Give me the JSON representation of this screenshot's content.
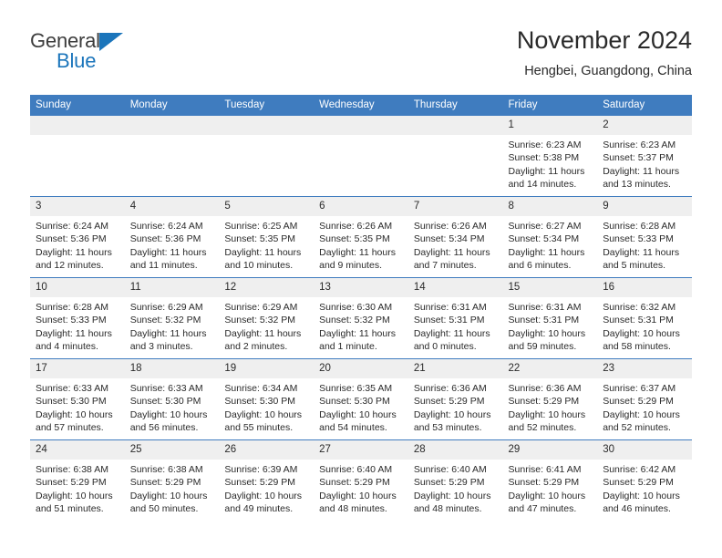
{
  "brand": {
    "line1": "General",
    "line2": "Blue",
    "triangle_color": "#1b75bb",
    "text_color": "#3d3d3d"
  },
  "header": {
    "title": "November 2024",
    "subtitle": "Hengbei, Guangdong, China"
  },
  "theme": {
    "header_row_bg": "#3f7cbf",
    "header_row_text": "#ffffff",
    "daynum_bg": "#efefef",
    "grid_line": "#3f7cbf",
    "body_text": "#2a2a2a"
  },
  "weekday_headers": [
    "Sunday",
    "Monday",
    "Tuesday",
    "Wednesday",
    "Thursday",
    "Friday",
    "Saturday"
  ],
  "weeks": [
    [
      {
        "day": "",
        "sunrise": "",
        "sunset": "",
        "daylight1": "",
        "daylight2": ""
      },
      {
        "day": "",
        "sunrise": "",
        "sunset": "",
        "daylight1": "",
        "daylight2": ""
      },
      {
        "day": "",
        "sunrise": "",
        "sunset": "",
        "daylight1": "",
        "daylight2": ""
      },
      {
        "day": "",
        "sunrise": "",
        "sunset": "",
        "daylight1": "",
        "daylight2": ""
      },
      {
        "day": "",
        "sunrise": "",
        "sunset": "",
        "daylight1": "",
        "daylight2": ""
      },
      {
        "day": "1",
        "sunrise": "Sunrise: 6:23 AM",
        "sunset": "Sunset: 5:38 PM",
        "daylight1": "Daylight: 11 hours",
        "daylight2": "and 14 minutes."
      },
      {
        "day": "2",
        "sunrise": "Sunrise: 6:23 AM",
        "sunset": "Sunset: 5:37 PM",
        "daylight1": "Daylight: 11 hours",
        "daylight2": "and 13 minutes."
      }
    ],
    [
      {
        "day": "3",
        "sunrise": "Sunrise: 6:24 AM",
        "sunset": "Sunset: 5:36 PM",
        "daylight1": "Daylight: 11 hours",
        "daylight2": "and 12 minutes."
      },
      {
        "day": "4",
        "sunrise": "Sunrise: 6:24 AM",
        "sunset": "Sunset: 5:36 PM",
        "daylight1": "Daylight: 11 hours",
        "daylight2": "and 11 minutes."
      },
      {
        "day": "5",
        "sunrise": "Sunrise: 6:25 AM",
        "sunset": "Sunset: 5:35 PM",
        "daylight1": "Daylight: 11 hours",
        "daylight2": "and 10 minutes."
      },
      {
        "day": "6",
        "sunrise": "Sunrise: 6:26 AM",
        "sunset": "Sunset: 5:35 PM",
        "daylight1": "Daylight: 11 hours",
        "daylight2": "and 9 minutes."
      },
      {
        "day": "7",
        "sunrise": "Sunrise: 6:26 AM",
        "sunset": "Sunset: 5:34 PM",
        "daylight1": "Daylight: 11 hours",
        "daylight2": "and 7 minutes."
      },
      {
        "day": "8",
        "sunrise": "Sunrise: 6:27 AM",
        "sunset": "Sunset: 5:34 PM",
        "daylight1": "Daylight: 11 hours",
        "daylight2": "and 6 minutes."
      },
      {
        "day": "9",
        "sunrise": "Sunrise: 6:28 AM",
        "sunset": "Sunset: 5:33 PM",
        "daylight1": "Daylight: 11 hours",
        "daylight2": "and 5 minutes."
      }
    ],
    [
      {
        "day": "10",
        "sunrise": "Sunrise: 6:28 AM",
        "sunset": "Sunset: 5:33 PM",
        "daylight1": "Daylight: 11 hours",
        "daylight2": "and 4 minutes."
      },
      {
        "day": "11",
        "sunrise": "Sunrise: 6:29 AM",
        "sunset": "Sunset: 5:32 PM",
        "daylight1": "Daylight: 11 hours",
        "daylight2": "and 3 minutes."
      },
      {
        "day": "12",
        "sunrise": "Sunrise: 6:29 AM",
        "sunset": "Sunset: 5:32 PM",
        "daylight1": "Daylight: 11 hours",
        "daylight2": "and 2 minutes."
      },
      {
        "day": "13",
        "sunrise": "Sunrise: 6:30 AM",
        "sunset": "Sunset: 5:32 PM",
        "daylight1": "Daylight: 11 hours",
        "daylight2": "and 1 minute."
      },
      {
        "day": "14",
        "sunrise": "Sunrise: 6:31 AM",
        "sunset": "Sunset: 5:31 PM",
        "daylight1": "Daylight: 11 hours",
        "daylight2": "and 0 minutes."
      },
      {
        "day": "15",
        "sunrise": "Sunrise: 6:31 AM",
        "sunset": "Sunset: 5:31 PM",
        "daylight1": "Daylight: 10 hours",
        "daylight2": "and 59 minutes."
      },
      {
        "day": "16",
        "sunrise": "Sunrise: 6:32 AM",
        "sunset": "Sunset: 5:31 PM",
        "daylight1": "Daylight: 10 hours",
        "daylight2": "and 58 minutes."
      }
    ],
    [
      {
        "day": "17",
        "sunrise": "Sunrise: 6:33 AM",
        "sunset": "Sunset: 5:30 PM",
        "daylight1": "Daylight: 10 hours",
        "daylight2": "and 57 minutes."
      },
      {
        "day": "18",
        "sunrise": "Sunrise: 6:33 AM",
        "sunset": "Sunset: 5:30 PM",
        "daylight1": "Daylight: 10 hours",
        "daylight2": "and 56 minutes."
      },
      {
        "day": "19",
        "sunrise": "Sunrise: 6:34 AM",
        "sunset": "Sunset: 5:30 PM",
        "daylight1": "Daylight: 10 hours",
        "daylight2": "and 55 minutes."
      },
      {
        "day": "20",
        "sunrise": "Sunrise: 6:35 AM",
        "sunset": "Sunset: 5:30 PM",
        "daylight1": "Daylight: 10 hours",
        "daylight2": "and 54 minutes."
      },
      {
        "day": "21",
        "sunrise": "Sunrise: 6:36 AM",
        "sunset": "Sunset: 5:29 PM",
        "daylight1": "Daylight: 10 hours",
        "daylight2": "and 53 minutes."
      },
      {
        "day": "22",
        "sunrise": "Sunrise: 6:36 AM",
        "sunset": "Sunset: 5:29 PM",
        "daylight1": "Daylight: 10 hours",
        "daylight2": "and 52 minutes."
      },
      {
        "day": "23",
        "sunrise": "Sunrise: 6:37 AM",
        "sunset": "Sunset: 5:29 PM",
        "daylight1": "Daylight: 10 hours",
        "daylight2": "and 52 minutes."
      }
    ],
    [
      {
        "day": "24",
        "sunrise": "Sunrise: 6:38 AM",
        "sunset": "Sunset: 5:29 PM",
        "daylight1": "Daylight: 10 hours",
        "daylight2": "and 51 minutes."
      },
      {
        "day": "25",
        "sunrise": "Sunrise: 6:38 AM",
        "sunset": "Sunset: 5:29 PM",
        "daylight1": "Daylight: 10 hours",
        "daylight2": "and 50 minutes."
      },
      {
        "day": "26",
        "sunrise": "Sunrise: 6:39 AM",
        "sunset": "Sunset: 5:29 PM",
        "daylight1": "Daylight: 10 hours",
        "daylight2": "and 49 minutes."
      },
      {
        "day": "27",
        "sunrise": "Sunrise: 6:40 AM",
        "sunset": "Sunset: 5:29 PM",
        "daylight1": "Daylight: 10 hours",
        "daylight2": "and 48 minutes."
      },
      {
        "day": "28",
        "sunrise": "Sunrise: 6:40 AM",
        "sunset": "Sunset: 5:29 PM",
        "daylight1": "Daylight: 10 hours",
        "daylight2": "and 48 minutes."
      },
      {
        "day": "29",
        "sunrise": "Sunrise: 6:41 AM",
        "sunset": "Sunset: 5:29 PM",
        "daylight1": "Daylight: 10 hours",
        "daylight2": "and 47 minutes."
      },
      {
        "day": "30",
        "sunrise": "Sunrise: 6:42 AM",
        "sunset": "Sunset: 5:29 PM",
        "daylight1": "Daylight: 10 hours",
        "daylight2": "and 46 minutes."
      }
    ]
  ]
}
